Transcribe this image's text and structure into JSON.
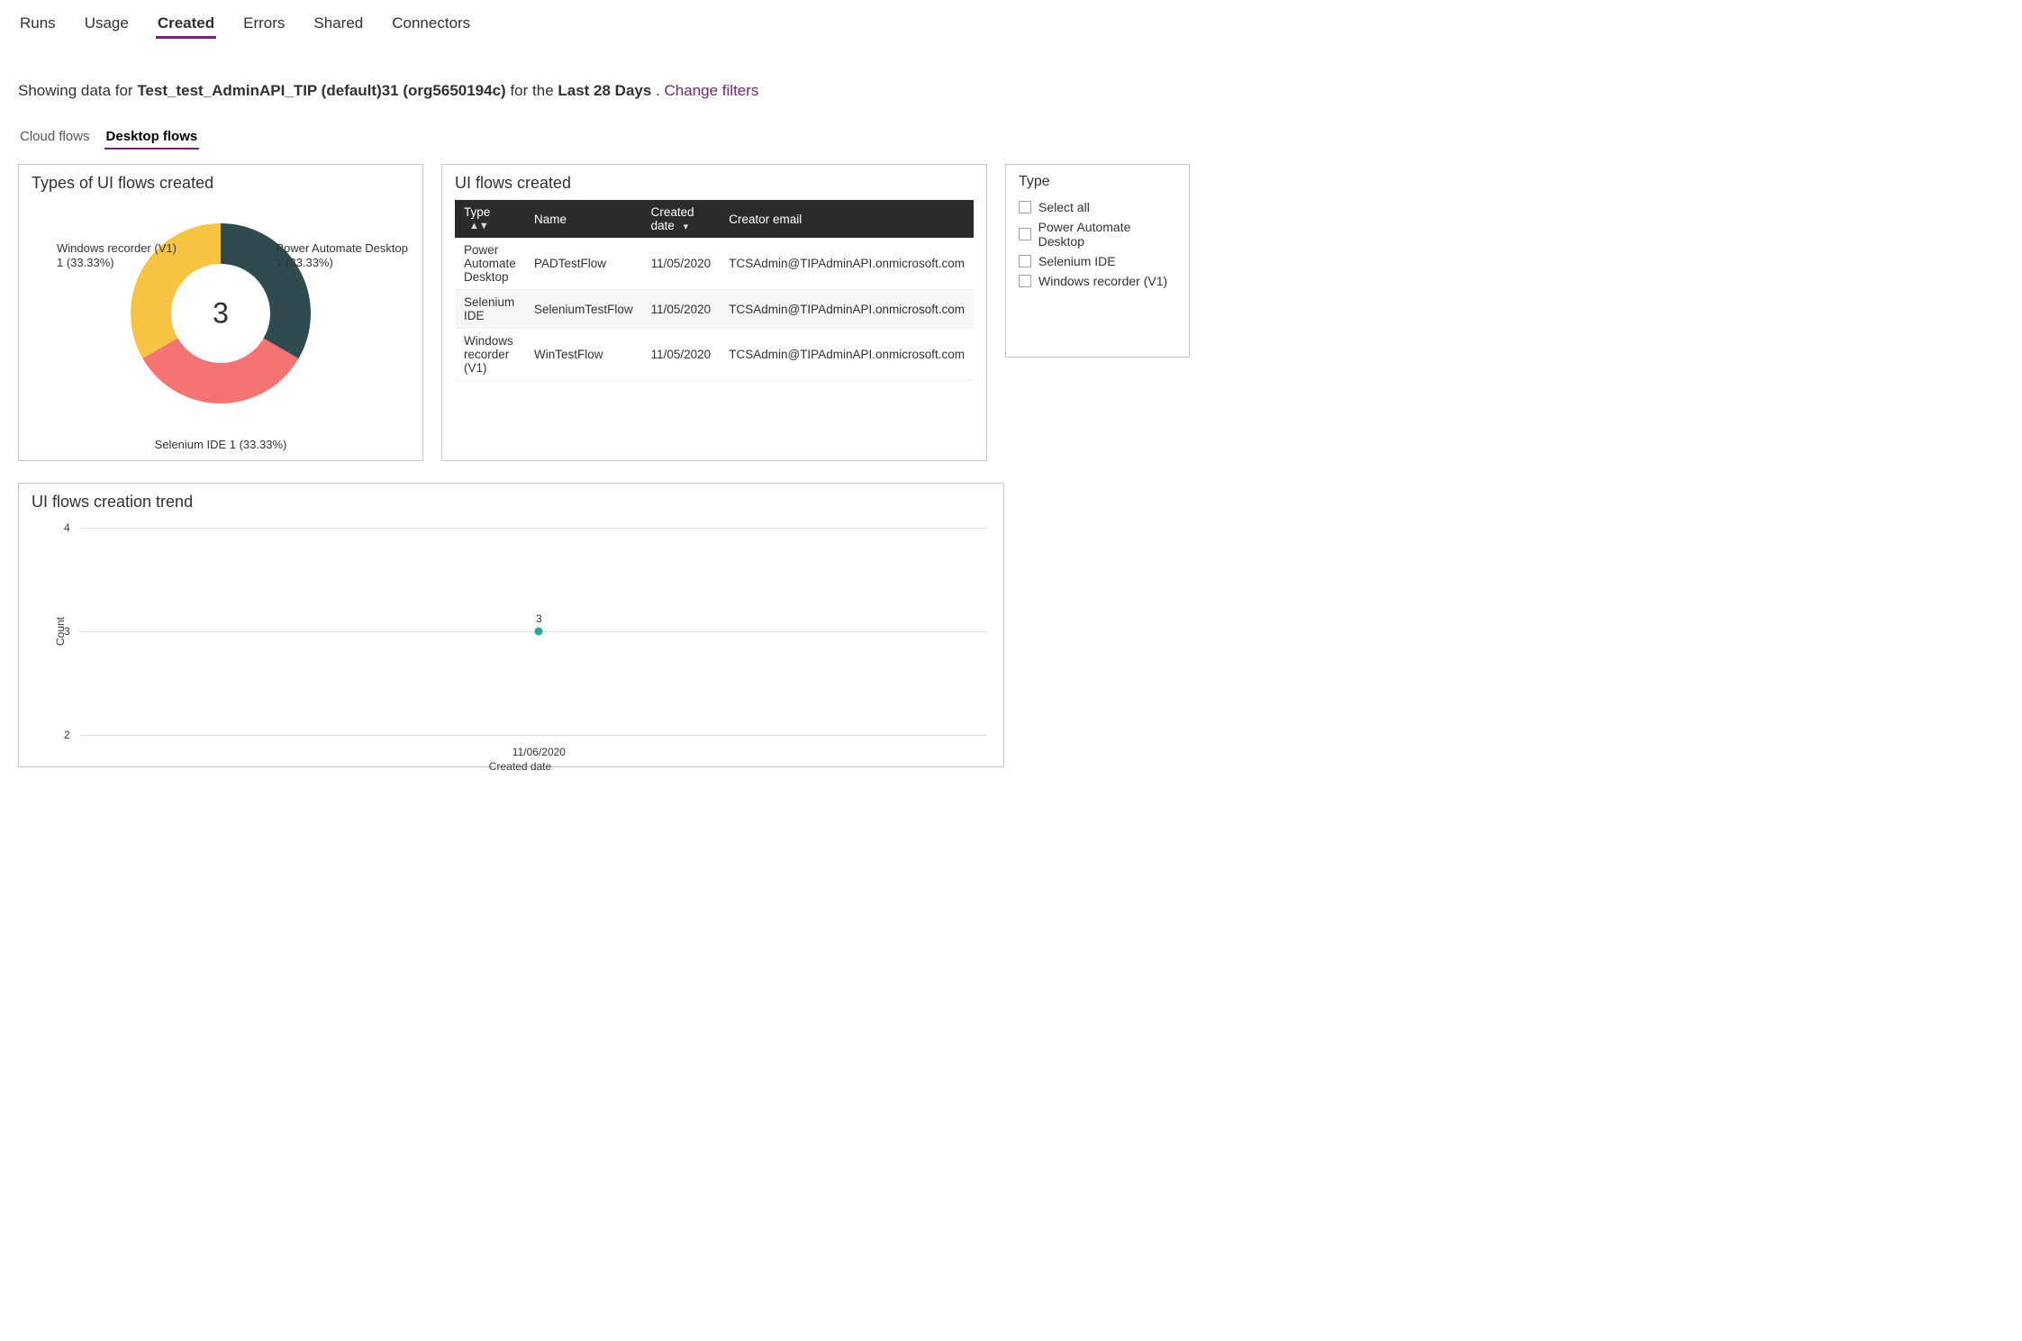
{
  "top_tabs": {
    "items": [
      "Runs",
      "Usage",
      "Created",
      "Errors",
      "Shared",
      "Connectors"
    ],
    "active_index": 2
  },
  "filter_line": {
    "prefix": "Showing data for ",
    "env_name": "Test_test_AdminAPI_TIP (default)31 (org5650194c)",
    "mid": " for the ",
    "range": "Last 28 Days",
    "suffix": ". ",
    "change_filters": "Change filters"
  },
  "sub_tabs": {
    "items": [
      "Cloud flows",
      "Desktop flows"
    ],
    "active_index": 1
  },
  "types_card": {
    "title": "Types of UI flows created",
    "center": "3",
    "labels": {
      "pad_line1": "Power Automate Desktop",
      "pad_line2": "1 (33.33%)",
      "win_line1": "Windows recorder (V1)",
      "win_line2": "1 (33.33%)",
      "sel": "Selenium IDE 1 (33.33%)"
    }
  },
  "table_card": {
    "title": "UI flows created",
    "headers": {
      "type": "Type",
      "name": "Name",
      "created": "Created date",
      "email": "Creator email"
    },
    "rows": [
      {
        "type": "Power Automate Desktop",
        "name": "PADTestFlow",
        "date": "11/05/2020",
        "email": "TCSAdmin@TIPAdminAPI.onmicrosoft.com"
      },
      {
        "type": "Selenium IDE",
        "name": "SeleniumTestFlow",
        "date": "11/05/2020",
        "email": "TCSAdmin@TIPAdminAPI.onmicrosoft.com"
      },
      {
        "type": "Windows recorder (V1)",
        "name": "WinTestFlow",
        "date": "11/05/2020",
        "email": "TCSAdmin@TIPAdminAPI.onmicrosoft.com"
      }
    ]
  },
  "filter_card": {
    "title": "Type",
    "options": [
      "Select all",
      "Power Automate Desktop",
      "Selenium IDE",
      "Windows recorder (V1)"
    ]
  },
  "trend_card": {
    "title": "UI flows creation trend",
    "y_label": "Count",
    "x_label": "Created date",
    "y_ticks": [
      "4",
      "3",
      "2"
    ],
    "x_ticks": [
      "11/06/2020"
    ],
    "point_label": "3"
  },
  "chart_data": [
    {
      "type": "pie",
      "title": "Types of UI flows created",
      "series": [
        {
          "name": "Power Automate Desktop",
          "value": 1,
          "pct": 33.33,
          "color": "#2f4b4f"
        },
        {
          "name": "Selenium IDE",
          "value": 1,
          "pct": 33.33,
          "color": "#f47373"
        },
        {
          "name": "Windows recorder (V1)",
          "value": 1,
          "pct": 33.33,
          "color": "#f6c343"
        }
      ],
      "total": 3
    },
    {
      "type": "line",
      "title": "UI flows creation trend",
      "xlabel": "Created date",
      "ylabel": "Count",
      "ylim": [
        2,
        4
      ],
      "x": [
        "11/06/2020"
      ],
      "series": [
        {
          "name": "Count",
          "values": [
            3
          ]
        }
      ]
    },
    {
      "type": "table",
      "title": "UI flows created",
      "columns": [
        "Type",
        "Name",
        "Created date",
        "Creator email"
      ],
      "rows": [
        [
          "Power Automate Desktop",
          "PADTestFlow",
          "11/05/2020",
          "TCSAdmin@TIPAdminAPI.onmicrosoft.com"
        ],
        [
          "Selenium IDE",
          "SeleniumTestFlow",
          "11/05/2020",
          "TCSAdmin@TIPAdminAPI.onmicrosoft.com"
        ],
        [
          "Windows recorder (V1)",
          "WinTestFlow",
          "11/05/2020",
          "TCSAdmin@TIPAdminAPI.onmicrosoft.com"
        ]
      ]
    }
  ]
}
